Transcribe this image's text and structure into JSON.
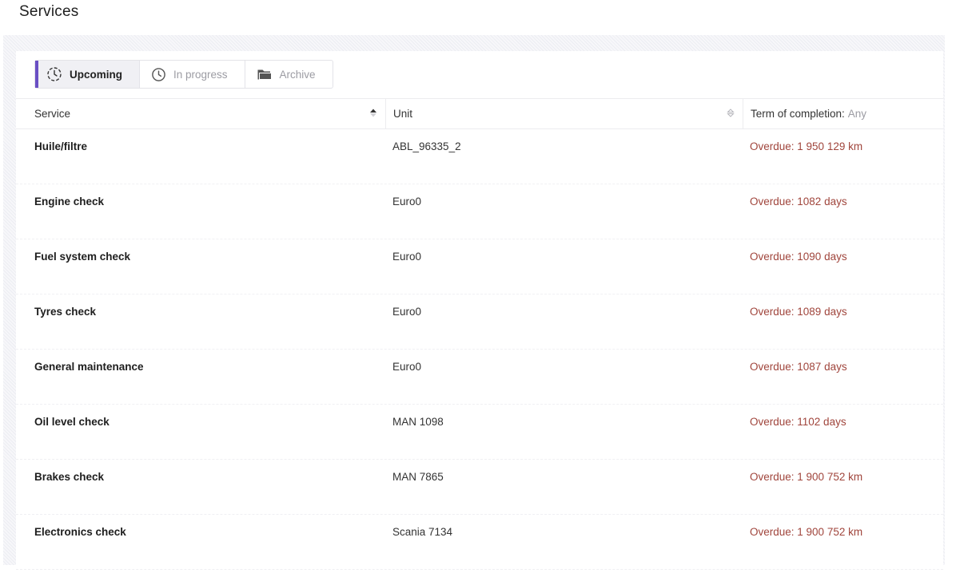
{
  "page": {
    "title": "Services"
  },
  "tabs": [
    {
      "label": "Upcoming",
      "icon": "clock-dashed-icon",
      "active": true
    },
    {
      "label": "In progress",
      "icon": "clock-icon",
      "active": false
    },
    {
      "label": "Archive",
      "icon": "folder-icon",
      "active": false
    }
  ],
  "table": {
    "headers": {
      "service": "Service",
      "unit": "Unit",
      "term": "Term of completion:",
      "term_filter": "Any"
    },
    "rows": [
      {
        "service": "Huile/filtre",
        "unit": "ABL_96335_2",
        "term": "Overdue: 1 950 129 km"
      },
      {
        "service": "Engine check",
        "unit": "Euro0",
        "term": "Overdue: 1082 days"
      },
      {
        "service": "Fuel system check",
        "unit": "Euro0",
        "term": "Overdue: 1090 days"
      },
      {
        "service": "Tyres check",
        "unit": "Euro0",
        "term": "Overdue: 1089 days"
      },
      {
        "service": "General maintenance",
        "unit": "Euro0",
        "term": "Overdue: 1087 days"
      },
      {
        "service": "Oil level check",
        "unit": "MAN 1098",
        "term": "Overdue: 1102 days"
      },
      {
        "service": "Brakes check",
        "unit": "MAN 7865",
        "term": "Overdue: 1 900 752 km"
      },
      {
        "service": "Electronics check",
        "unit": "Scania 7134",
        "term": "Overdue: 1 900 752 km"
      }
    ]
  },
  "colors": {
    "accent": "#6a4fc4",
    "overdue": "#a0453c"
  }
}
